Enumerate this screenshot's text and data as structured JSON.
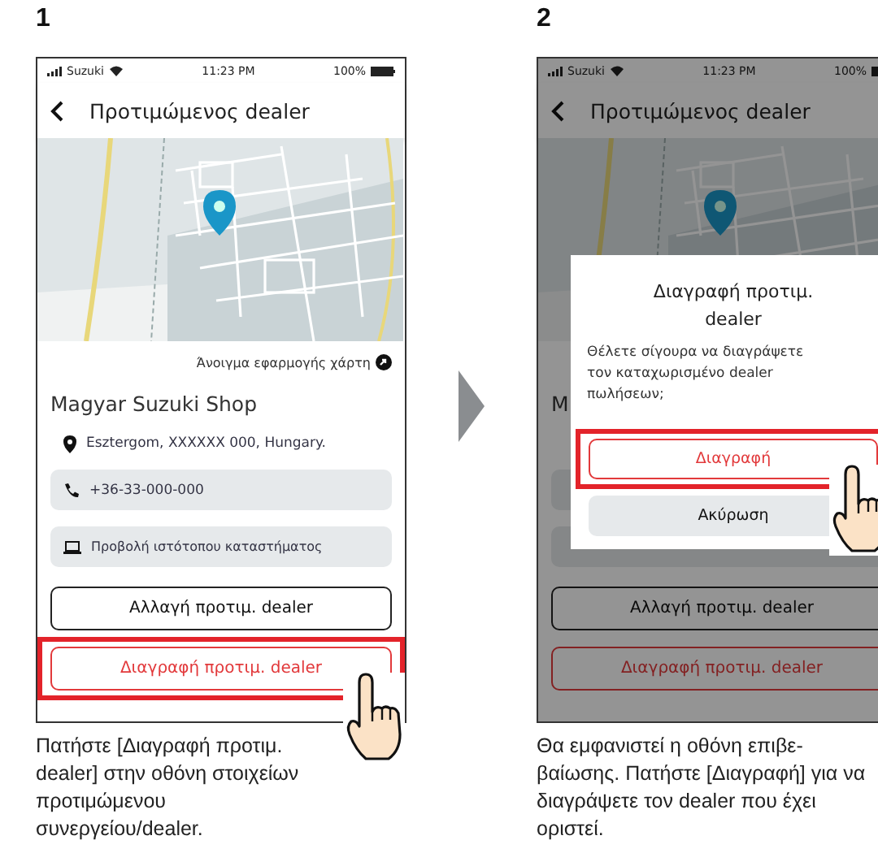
{
  "steps": [
    {
      "number": "1",
      "screen": {
        "status_bar": {
          "carrier": "Suzuki",
          "time": "11:23 PM",
          "battery": "100%"
        },
        "title": "Προτιμώμενος dealer",
        "map_link": "Άνοιγμα εφαρμογής χάρτη",
        "shop_name": "Magyar Suzuki Shop",
        "address": "Esztergom, XXXXXX 000, Hungary.",
        "phone": "+36-33-000-000",
        "website": "Προβολή ιστότοπου καταστήματος",
        "buttons": [
          {
            "label": "Αλλαγή προτιμ. dealer",
            "kind": "outline",
            "highlighted": false
          },
          {
            "label": "Διαγραφή προτιμ. dealer",
            "kind": "danger",
            "highlighted": true
          }
        ]
      },
      "caption": "Πατήστε [Διαγραφή προτιμ. dealer] στην οθόνη στοιχείων προτιμώμενου συνεργείου/dealer."
    },
    {
      "number": "2",
      "screen": {
        "status_bar": {
          "carrier": "Suzuki",
          "time": "11:23 PM",
          "battery": "100%"
        },
        "title": "Προτιμώμενος dealer",
        "shop_name": "M",
        "buttons": [
          {
            "label": "Αλλαγή προτιμ. dealer",
            "kind": "outline",
            "highlighted": false
          },
          {
            "label": "Διαγραφή προτιμ. dealer",
            "kind": "danger",
            "highlighted": false
          }
        ],
        "dialog": {
          "title": "Διαγραφή προτιμ. dealer",
          "message": "Θέλετε σίγουρα να διαγράψετε τον καταχωρισμένο dealer πωλήσεων;",
          "buttons": [
            {
              "label": "Διαγραφή",
              "kind": "danger",
              "highlighted": true
            },
            {
              "label": "Ακύρωση",
              "kind": "grey",
              "highlighted": false
            }
          ]
        }
      },
      "caption": "Θα εμφανιστεί η οθόνη επιβε-βαίωσης. Πατήστε [Διαγραφή] για να διαγράψετε τον dealer που έχει οριστεί."
    }
  ]
}
